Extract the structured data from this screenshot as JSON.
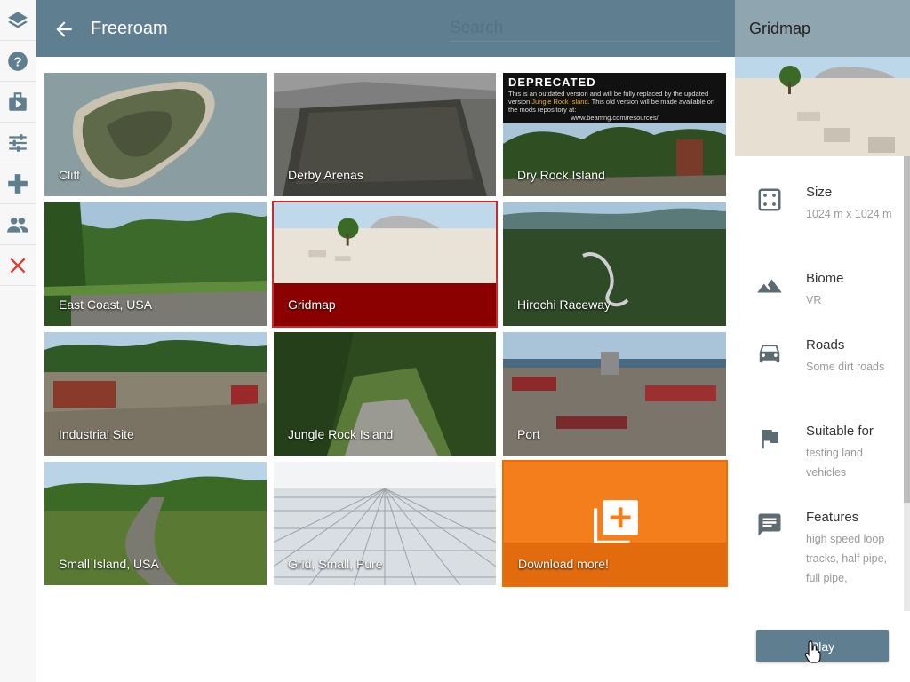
{
  "sidebar": {
    "items": [
      {
        "icon": "layers-icon"
      },
      {
        "icon": "help-icon"
      },
      {
        "icon": "briefcase-play-icon"
      },
      {
        "icon": "sliders-icon"
      },
      {
        "icon": "gamepad-icon"
      },
      {
        "icon": "people-icon"
      },
      {
        "icon": "close-icon",
        "color": "#e53935"
      }
    ]
  },
  "header": {
    "title": "Freeroam",
    "search_placeholder": "Search"
  },
  "levels": [
    {
      "label": "Cliff"
    },
    {
      "label": "Derby Arenas"
    },
    {
      "label": "Dry Rock Island",
      "deprecated_title": "DEPRECATED",
      "deprecated_text_1": "This is an outdated version and will be fully replaced by the updated version ",
      "deprecated_link": "Jungle Rock Island",
      "deprecated_text_2": ". This old version will be made available on the mods repository at:",
      "deprecated_url": "www.beamng.com/resources/"
    },
    {
      "label": "East Coast, USA"
    },
    {
      "label": "Gridmap"
    },
    {
      "label": "Hirochi Raceway"
    },
    {
      "label": "Industrial Site"
    },
    {
      "label": "Jungle Rock Island"
    },
    {
      "label": "Port"
    },
    {
      "label": "Small Island, USA"
    },
    {
      "label": "Grid, Small, Pure"
    },
    {
      "label": "Download more!"
    }
  ],
  "details": {
    "title": "Gridmap",
    "rows": [
      {
        "key": "Size",
        "value": "1024 m x 1024 m",
        "icon": "dice-icon"
      },
      {
        "key": "Biome",
        "value": "VR",
        "icon": "mountain-icon"
      },
      {
        "key": "Roads",
        "value": "Some dirt roads",
        "icon": "car-icon"
      },
      {
        "key": "Suitable for",
        "value": "testing land vehicles",
        "icon": "flag-icon"
      },
      {
        "key": "Features",
        "value": "high speed loop tracks, half pipe, full pipe,",
        "icon": "comment-icon"
      }
    ],
    "play_label": "Play"
  },
  "colors": {
    "header": "#5f7f90",
    "panel_header": "#8fa5b0",
    "selected": "#8b0000",
    "download": "#f47e1b"
  }
}
